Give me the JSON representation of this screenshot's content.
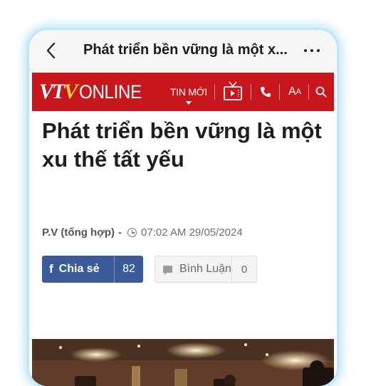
{
  "browser": {
    "title": "Phát triển bền vững là một x...",
    "back_icon": "chevron-left-icon",
    "more_icon": "more-horizontal-icon"
  },
  "site": {
    "logo_part1": "VT",
    "logo_part2": "V",
    "logo_part3": "ONLINE",
    "brand_color": "#c8161d",
    "nav": {
      "latest_label": "TIN MỚI",
      "tv_icon": "tv-icon",
      "phone_icon": "phone-icon",
      "font_label_big": "A",
      "font_label_small": "A",
      "search_icon": "search-icon"
    }
  },
  "article": {
    "headline": "Phát triển bền vững là một xu thế tất yếu",
    "author": "P.V (tổng hợp)",
    "separator": "-",
    "timestamp": "07:02 AM 29/05/2024",
    "share": {
      "fb_glyph": "f",
      "label": "Chia sẻ",
      "count": "82",
      "color": "#3b5a9a"
    },
    "comment": {
      "label": "Bình Luận",
      "count": "0"
    }
  }
}
